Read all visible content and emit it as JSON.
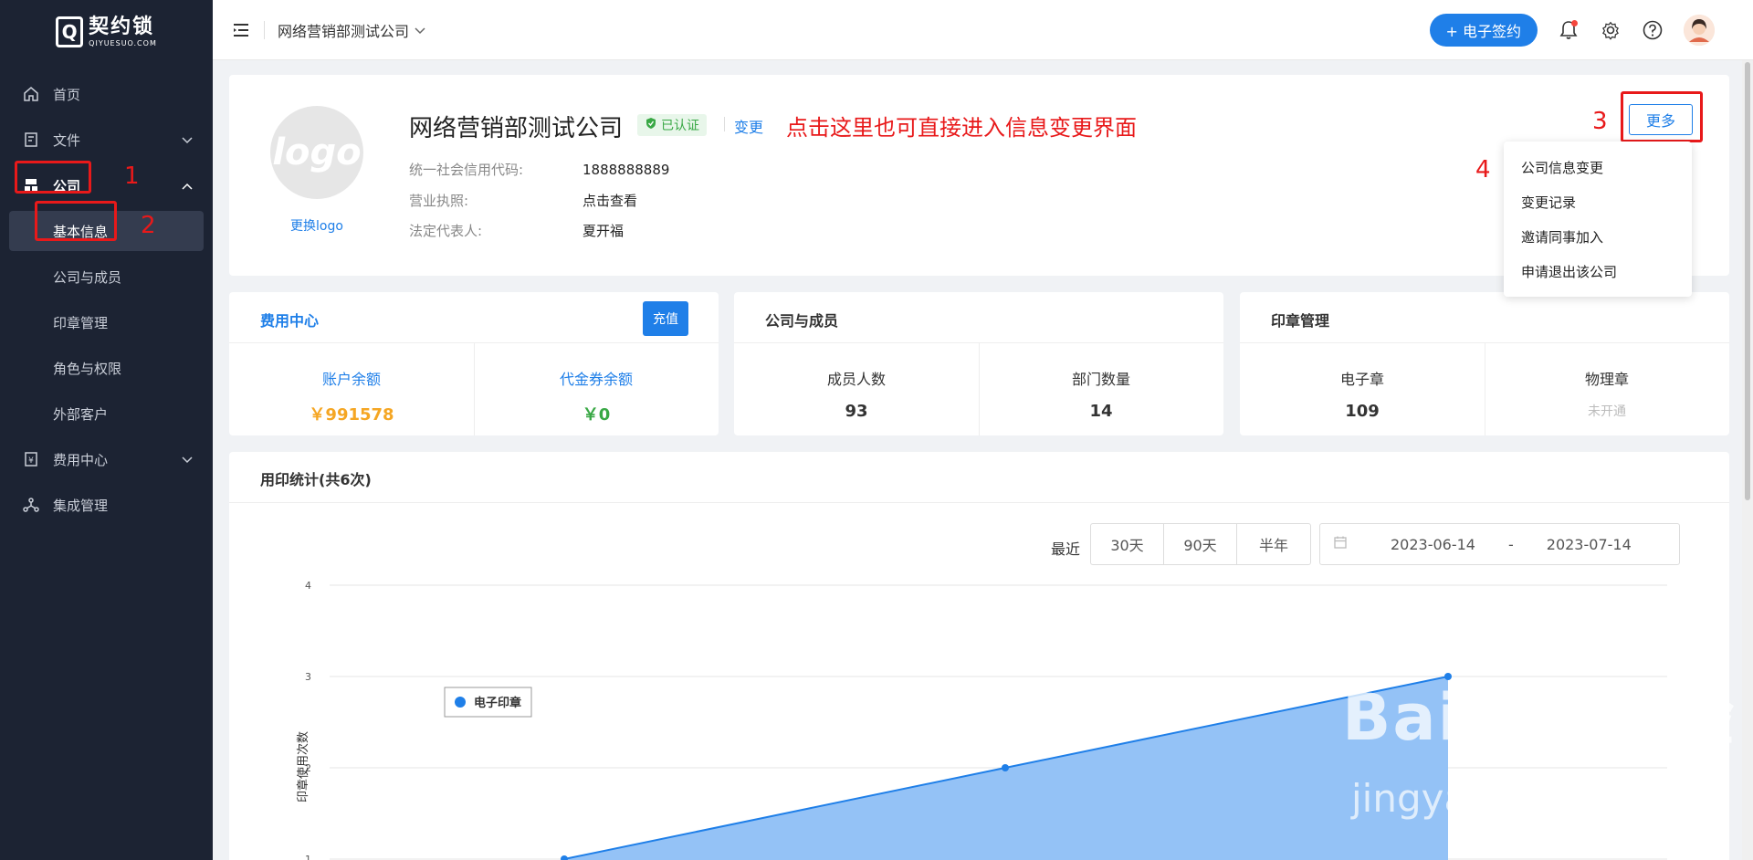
{
  "brand": {
    "name_cn": "契约锁",
    "name_en": "QIYUESUO.COM"
  },
  "sidebar": {
    "items": [
      {
        "label": "首页"
      },
      {
        "label": "文件"
      },
      {
        "label": "公司"
      },
      {
        "label": "费用中心"
      },
      {
        "label": "集成管理"
      }
    ],
    "company_subitems": [
      {
        "label": "基本信息"
      },
      {
        "label": "公司与成员"
      },
      {
        "label": "印章管理"
      },
      {
        "label": "角色与权限"
      },
      {
        "label": "外部客户"
      }
    ]
  },
  "header": {
    "company_switch": "网络营销部测试公司",
    "sign_button": "+ 电子签约"
  },
  "annotations": {
    "n1": "1",
    "n2": "2",
    "n3": "3",
    "n4": "4",
    "hint": "点击这里也可直接进入信息变更界面"
  },
  "company": {
    "logo_text": "logo",
    "change_logo": "更换logo",
    "name": "网络营销部测试公司",
    "verified": "已认证",
    "change": "变更",
    "credit_code_label": "统一社会信用代码:",
    "credit_code": "1888888889",
    "license_label": "营业执照:",
    "license_value": "点击查看",
    "legal_rep_label": "法定代表人:",
    "legal_rep": "夏开福",
    "more_button": "更多"
  },
  "more_menu": [
    {
      "label": "公司信息变更"
    },
    {
      "label": "变更记录"
    },
    {
      "label": "邀请同事加入"
    },
    {
      "label": "申请退出该公司"
    }
  ],
  "fee_center": {
    "title": "费用中心",
    "recharge": "充值",
    "balance_label": "账户余额",
    "balance": "￥991578",
    "voucher_label": "代金券余额",
    "voucher": "￥0"
  },
  "members": {
    "title": "公司与成员",
    "count_label": "成员人数",
    "count": "93",
    "dept_label": "部门数量",
    "dept": "14"
  },
  "seals": {
    "title": "印章管理",
    "electronic_label": "电子章",
    "electronic": "109",
    "physical_label": "物理章",
    "physical": "未开通"
  },
  "usage": {
    "title": "用印统计(共6次)",
    "recent_label": "最近",
    "periods": [
      "30天",
      "90天",
      "半年"
    ],
    "date_from": "2023-06-14",
    "date_sep": "-",
    "date_to": "2023-07-14"
  },
  "chart_data": {
    "type": "area",
    "title": "",
    "xlabel": "",
    "ylabel": "印章使用次数",
    "ylim": [
      1,
      4
    ],
    "y_ticks": [
      "1",
      "2",
      "3",
      "4"
    ],
    "series": [
      {
        "name": "电子印章",
        "color": "#8ebff5",
        "line_color": "#1f7fe8",
        "points": [
          [
            0,
            1
          ],
          [
            1,
            2
          ],
          [
            2,
            3
          ]
        ]
      }
    ],
    "legend": "top-left"
  },
  "watermark": {
    "main": "Bai du 经验",
    "sub": "jingyan.baidu.com"
  },
  "colors": {
    "accent": "#1f7fe8",
    "sidebar": "#1c2333",
    "annotation": "#e8191a",
    "balance": "#f5a623",
    "voucher": "#39a845"
  }
}
